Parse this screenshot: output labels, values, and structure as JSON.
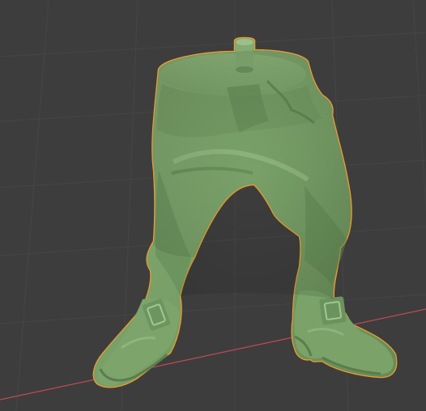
{
  "viewport": {
    "background_color": "#3d3d3d",
    "grid_color": "#454545",
    "x_axis_color": "#c04a55",
    "selection_outline_color": "#f39b2e",
    "model_color": "#7fa56d",
    "model_shadow_color": "#5b7d4d",
    "model_highlight_color": "#9cc08a"
  },
  "scene": {
    "object": "selected-sculpt-model",
    "icon": "mesh-object-icon"
  }
}
